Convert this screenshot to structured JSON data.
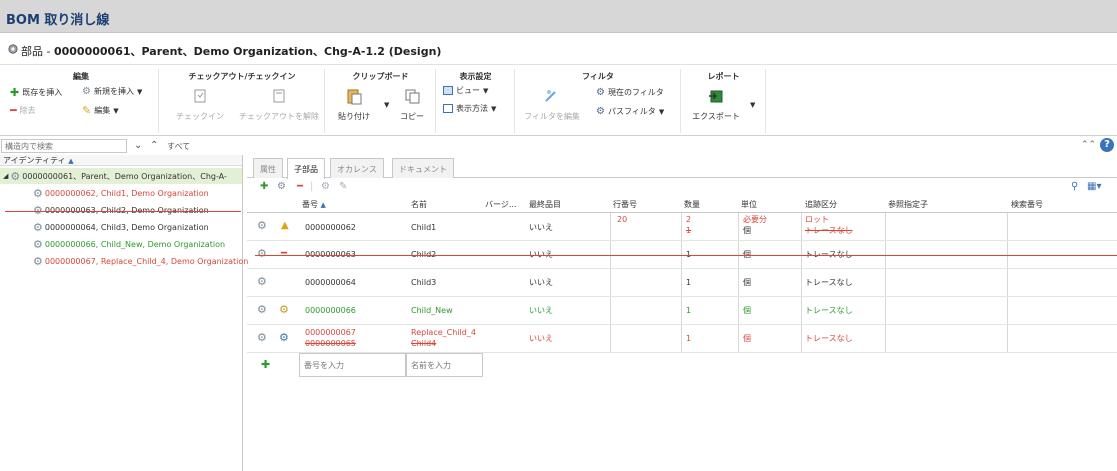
{
  "title": "BOM 取り消し線",
  "path": {
    "prefix": "部品 - ",
    "bold": "0000000061、Parent、Demo Organization、Chg-A-1.2 (Design)"
  },
  "ribbon": {
    "edit": {
      "title": "編集",
      "insert_existing": "既存を挿入",
      "insert_new": "新規を挿入",
      "remove": "除去",
      "edit": "編集"
    },
    "checkout": {
      "title": "チェックアウト/チェックイン",
      "checkin": "チェックイン",
      "undo_checkout": "チェックアウトを解除"
    },
    "clipboard": {
      "title": "クリップボード",
      "paste": "貼り付け",
      "copy": "コピー"
    },
    "display": {
      "title": "表示設定",
      "view": "ビュー",
      "display_method": "表示方法"
    },
    "filter": {
      "title": "フィルタ",
      "edit_filter": "フィルタを編集",
      "current_filter": "現在のフィルタ",
      "path_filter": "パスフィルタ"
    },
    "report": {
      "title": "レポート",
      "export": "エクスポート"
    }
  },
  "search": {
    "placeholder": "構造内で検索",
    "all": "すべて"
  },
  "tree": {
    "header": "アイデンティティ",
    "root": "0000000061、Parent、Demo Organization、Chg-A-",
    "items": [
      "0000000062, Child1, Demo Organization",
      "0000000063, Child2, Demo Organization",
      "0000000064, Child3, Demo Organization",
      "0000000066, Child_New, Demo Organization",
      "0000000067, Replace_Child_4, Demo Organization"
    ]
  },
  "tabs": [
    "属性",
    "子部品",
    "オカレンス",
    "ドキュメント"
  ],
  "columns": [
    "番号",
    "名前",
    "バージ...",
    "最終品目",
    "行番号",
    "数量",
    "単位",
    "追跡区分",
    "参照指定子",
    "検索番号"
  ],
  "rows": [
    {
      "number": "0000000062",
      "name": "Child1",
      "final": "いいえ",
      "line": "20",
      "qty_new": "2",
      "qty_old": "1",
      "unit_new": "必要分",
      "unit_old": "個",
      "trace_new": "ロット",
      "trace_old": "トレースなし"
    },
    {
      "number": "0000000063",
      "name": "Child2",
      "final": "いいえ",
      "line": "",
      "qty": "1",
      "unit": "個",
      "trace": "トレースなし"
    },
    {
      "number": "0000000064",
      "name": "Child3",
      "final": "いいえ",
      "line": "",
      "qty": "1",
      "unit": "個",
      "trace": "トレースなし"
    },
    {
      "number": "0000000066",
      "name": "Child_New",
      "final": "いいえ",
      "line": "",
      "qty": "1",
      "unit": "個",
      "trace": "トレースなし"
    },
    {
      "number_new": "0000000067",
      "number_old": "0000000065",
      "name_new": "Replace_Child_4",
      "name_old": "Child4",
      "final": "いいえ",
      "line": "",
      "qty": "1",
      "unit": "個",
      "trace": "トレースなし"
    }
  ],
  "new_row": {
    "number_placeholder": "番号を入力",
    "name_placeholder": "名前を入力"
  },
  "colors": {
    "title_blue": "#1c3f73",
    "red": "#d9463b",
    "green": "#2c9a2c"
  }
}
